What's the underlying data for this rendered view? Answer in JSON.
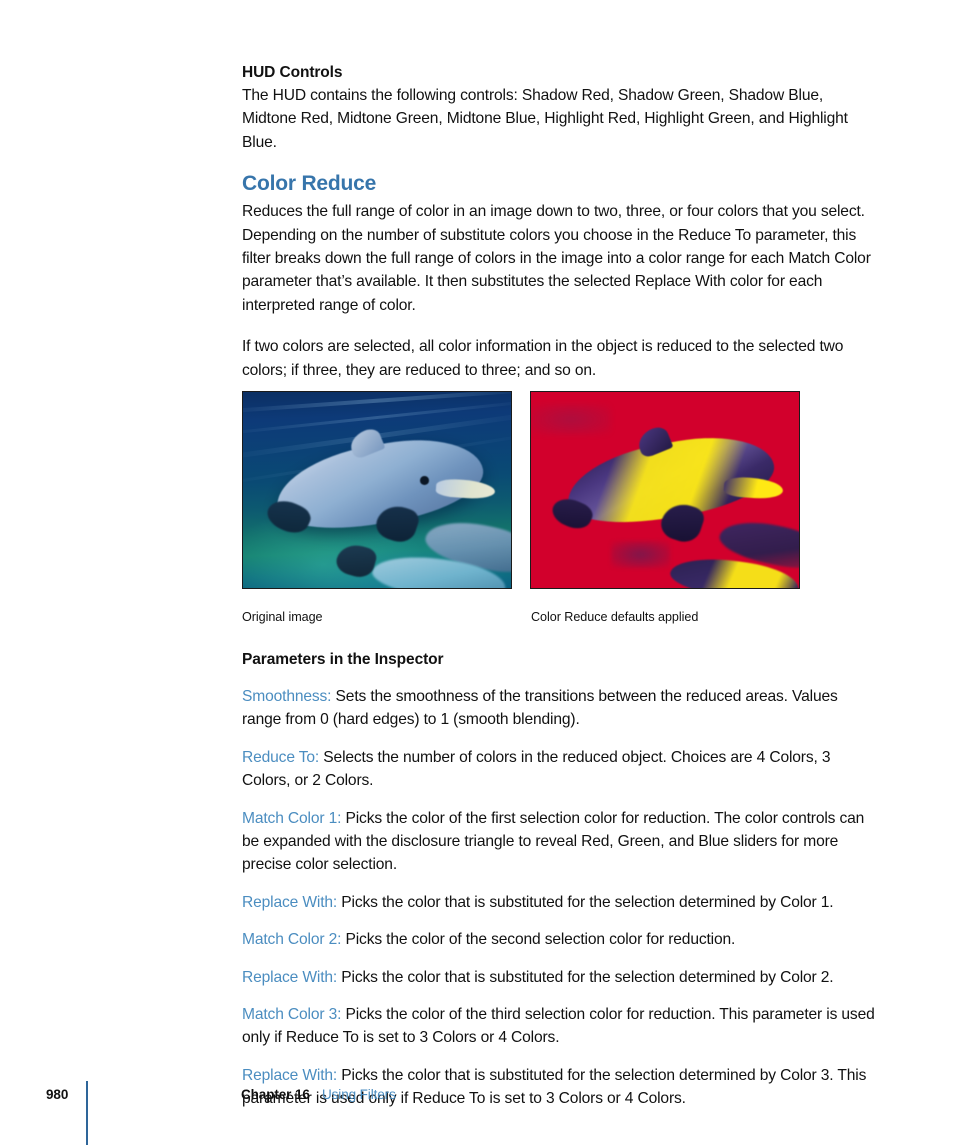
{
  "page": {
    "number": "980",
    "chapter": "Chapter 16",
    "chapter_title": "Using Filters",
    "heading_color": "#3775ab",
    "param_label_color": "#4b8dc0",
    "rule_color": "#2e6599"
  },
  "hud_section": {
    "heading": "HUD Controls",
    "paragraph": "The HUD contains the following controls: Shadow Red, Shadow Green, Shadow Blue, Midtone Red, Midtone Green, Midtone Blue, Highlight Red, Highlight Green, and Highlight Blue."
  },
  "color_reduce": {
    "heading": "Color Reduce",
    "paragraph_1": "Reduces the full range of color in an image down to two, three, or four colors that you select. Depending on the number of substitute colors you choose in the Reduce To parameter, this filter breaks down the full range of colors in the image into a color range for each Match Color parameter that’s available. It then substitutes the selected Replace With color for each interpreted range of color.",
    "paragraph_2": "If two colors are selected, all color information in the object is reduced to the selected two colors; if three, they are reduced to three; and so on."
  },
  "figures": {
    "left": {
      "caption": "Original image",
      "alt": "underwater-dolphin-photo",
      "colors": {
        "water_top": "#0b2f63",
        "water_bottom": "#12706c",
        "dolphin": "#a9c0dc"
      }
    },
    "right": {
      "caption": "Color Reduce defaults applied",
      "alt": "color-reduced-dolphin-photo",
      "colors": {
        "background": "#d2002c",
        "highlight": "#ffe814",
        "shadow": "#2b1d52"
      }
    }
  },
  "parameters": {
    "heading": "Parameters in the Inspector",
    "items": [
      {
        "label": "Smoothness:",
        "text": " Sets the smoothness of the transitions between the reduced areas. Values range from 0 (hard edges) to 1 (smooth blending)."
      },
      {
        "label": "Reduce To:",
        "text": " Selects the number of colors in the reduced object. Choices are 4 Colors, 3 Colors, or 2 Colors."
      },
      {
        "label": "Match Color 1:",
        "text": " Picks the color of the first selection color for reduction. The color controls can be expanded with the disclosure triangle to reveal Red, Green, and Blue sliders for more precise color selection."
      },
      {
        "label": "Replace With:",
        "text": " Picks the color that is substituted for the selection determined by Color 1."
      },
      {
        "label": "Match Color 2:",
        "text": " Picks the color of the second selection color for reduction."
      },
      {
        "label": "Replace With:",
        "text": " Picks the color that is substituted for the selection determined by Color 2."
      },
      {
        "label": "Match Color 3:",
        "text": " Picks the color of the third selection color for reduction. This parameter is used only if Reduce To is set to 3 Colors or 4 Colors."
      },
      {
        "label": "Replace With:",
        "text": " Picks the color that is substituted for the selection determined by Color 3. This parameter is used only if Reduce To is set to 3 Colors or 4 Colors."
      }
    ]
  }
}
